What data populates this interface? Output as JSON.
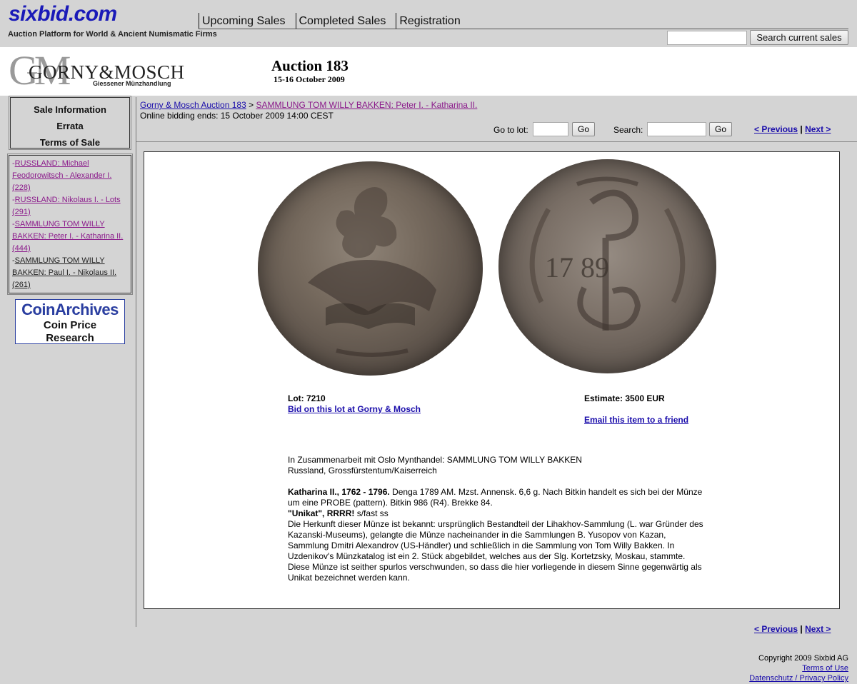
{
  "site": {
    "logo": "sixbid.com",
    "tagline": "Auction Platform for World & Ancient Numismatic Firms",
    "nav": [
      "Upcoming Sales",
      "Completed Sales",
      "Registration"
    ],
    "search_button": "Search current sales"
  },
  "banner": {
    "firm_letters": "GM",
    "firm_name": "GORNY&MOSCH",
    "firm_sub": "Giessener Münzhandlung",
    "auction_title": "Auction 183",
    "auction_dates": "15-16 October 2009"
  },
  "sidebar": {
    "info_links": [
      "Sale Information",
      "Errata",
      "Terms of Sale"
    ],
    "categories": [
      {
        "label": "RUSSLAND: Michael Feodorowitsch - Alexander I. (228)"
      },
      {
        "label": "RUSSLAND: Nikolaus I. - Lots (291)"
      },
      {
        "label": "SAMMLUNG TOM WILLY BAKKEN: Peter I. - Katharina II. (444)"
      },
      {
        "label": "SAMMLUNG TOM WILLY BAKKEN: Paul I. - Nikolaus II. (261)"
      }
    ],
    "coinarchives": {
      "name": "CoinArchives",
      "line1": "Coin Price",
      "line2": "Research"
    }
  },
  "main": {
    "breadcrumb": {
      "auction": "Gorny & Mosch Auction 183",
      "separator": " > ",
      "category": "SAMMLUNG TOM WILLY BAKKEN: Peter I. - Katharina II."
    },
    "bidding_ends": "Online bidding ends: 15 October 2009 14:00 CEST",
    "goto_label": "Go to lot:",
    "go_button": "Go",
    "search_label": "Search:",
    "search_go_button": "Go",
    "pager": {
      "previous": "< Previous",
      "separator": " | ",
      "next": "Next >"
    }
  },
  "lot": {
    "lot_number": "Lot: 7210",
    "bid_link": "Bid on this lot at Gorny & Mosch",
    "estimate": "Estimate: 3500 EUR",
    "email_link": "Email this item to a friend",
    "collection_line": "In Zusammenarbeit mit Oslo Mynthandel: SAMMLUNG TOM WILLY BAKKEN",
    "region_line": "Russland, Grossfürstentum/Kaiserreich",
    "ruler": "Katharina II., 1762 - 1796.",
    "description": " Denga 1789 AM. Mzst. Annensk. 6,6 g. Nach Bitkin handelt es sich bei der Münze um eine PROBE (pattern). Bitkin 986 (R4). Brekke 84.",
    "grade_bold": "\"Unikat\", RRRR!",
    "grade": " s/fast ss",
    "provenance": "Die Herkunft dieser Münze ist bekannt: ursprünglich Bestandteil der Lihakhov-Sammlung (L. war Gründer des Kazanski-Museums), gelangte die Münze nacheinander in die Sammlungen B. Yusopov von Kazan, Sammlung Dmitri Alexandrov (US-Händler) und schließlich in die Sammlung von Tom Willy Bakken. In Uzdenikov's Münzkatalog ist ein 2. Stück abgebildet, welches aus der Slg. Kortetzsky, Moskau, stammte. Diese Münze ist seither spurlos verschwunden, so dass die hier vorliegende in diesem Sinne gegenwärtig als Unikat bezeichnet werden kann.",
    "coin_reverse_date": "17 89"
  },
  "footer": {
    "copyright": "Copyright 2009 Sixbid AG",
    "terms": "Terms of Use",
    "privacy": "Datenschutz / Privacy Policy"
  },
  "colors": {
    "link": "#1a0dab",
    "visited": "#8b1a8b",
    "logo": "#1a1ab8",
    "background": "#d4d4d4"
  }
}
